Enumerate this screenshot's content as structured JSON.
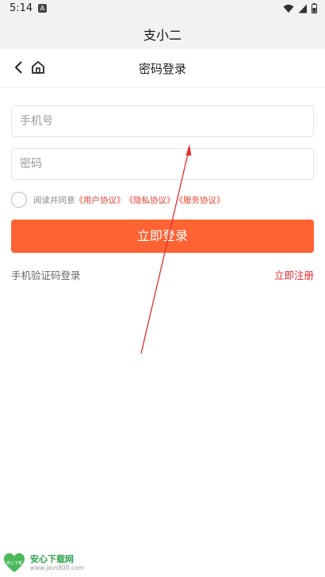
{
  "status_bar": {
    "time": "5:14",
    "notification_letter": "A"
  },
  "app": {
    "title": "支小二"
  },
  "nav": {
    "title": "密码登录"
  },
  "form": {
    "phone_placeholder": "手机号",
    "password_placeholder": "密码",
    "agree_prefix": "阅读并同意",
    "agreements": [
      "《用户协议》",
      "《隐私协议》",
      "《服务协议》"
    ],
    "login_label": "立即登录",
    "sms_login_label": "手机验证码登录",
    "register_label": "立即注册"
  },
  "watermark": {
    "title": "安心下载网",
    "url": "www.javs800.com",
    "logo_text": "安心下载"
  },
  "colors": {
    "accent": "#ff6233",
    "link_red": "#e8262b",
    "background": "#ffffff",
    "header_bg": "#f2f2f2",
    "annotation_arrow": "#e03030"
  },
  "icons": [
    "wifi-icon",
    "signal-icon",
    "battery-icon",
    "back-arrow-icon",
    "home-icon"
  ]
}
